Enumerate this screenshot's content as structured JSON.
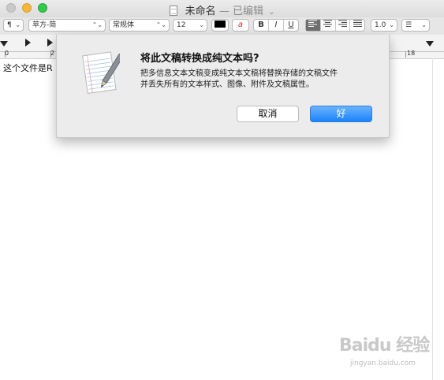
{
  "window": {
    "title": "未命名",
    "status": "— 已编辑",
    "status_chevron": "⌄"
  },
  "toolbar": {
    "paragraph_style": "¶",
    "font_family": "苹方-简",
    "font_style": "常规体",
    "font_size": "12",
    "highlight_glyph": "a",
    "bold": "B",
    "italic": "I",
    "underline": "U",
    "line_spacing": "1.0",
    "list_glyph": "☰",
    "popup_arrow": "⌃⌄",
    "alignment_icons": [
      "align-left-icon",
      "align-center-icon",
      "align-right-icon",
      "align-justify-icon"
    ],
    "selected_alignment": "align-left"
  },
  "ruler": {
    "labels": [
      "0",
      "2",
      "18"
    ]
  },
  "document": {
    "visible_text": "这个文件是R"
  },
  "dialog": {
    "title": "将此文稿转换成纯文本吗?",
    "message_line1": "把多信息文本文稿变成纯文本文稿将替换存储的文稿文件",
    "message_line2": "并丢失所有的文本样式、图像、附件及文稿属性。",
    "cancel_label": "取消",
    "ok_label": "好"
  },
  "watermark": {
    "site": "jingyan.baidu.com"
  },
  "colors": {
    "accent_blue": "#1a82fb",
    "traffic_close": "#c9c9c9",
    "traffic_minimize": "#f6b73a",
    "traffic_zoom": "#35c84a"
  }
}
